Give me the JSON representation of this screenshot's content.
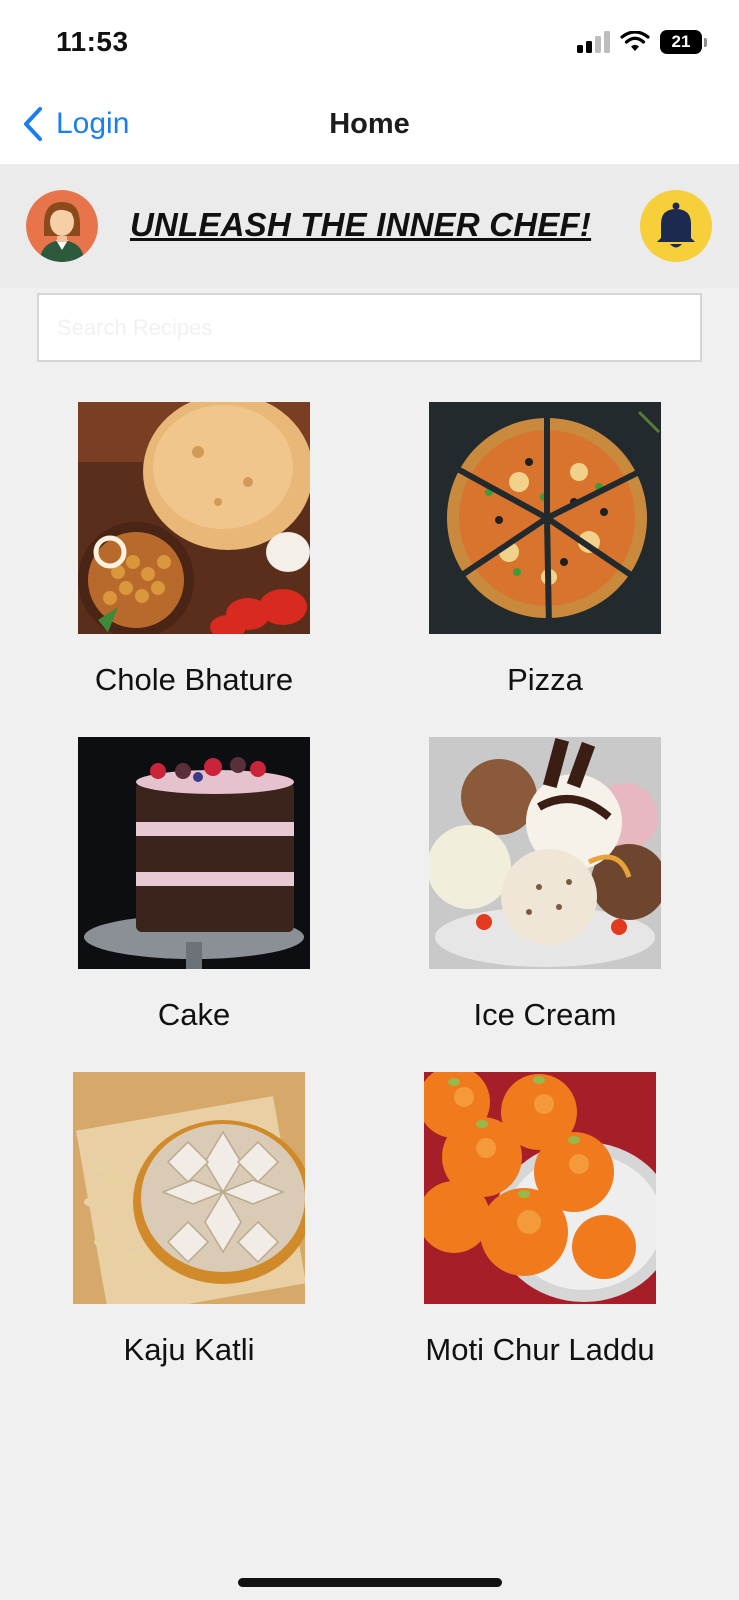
{
  "status_bar": {
    "time": "11:53",
    "battery_level": "21"
  },
  "nav": {
    "back_label": "Login",
    "title": "Home"
  },
  "header": {
    "headline": "UNLEASH THE INNER CHEF!"
  },
  "search": {
    "placeholder": "Search Recipes",
    "value": ""
  },
  "recipes": [
    {
      "name": "Chole Bhature",
      "image": "chole-bhature-photo"
    },
    {
      "name": "Pizza",
      "image": "pizza-photo"
    },
    {
      "name": "Cake",
      "image": "cake-photo"
    },
    {
      "name": "Ice Cream",
      "image": "ice-cream-photo"
    },
    {
      "name": "Kaju Katli",
      "image": "kaju-katli-photo"
    },
    {
      "name": "Moti Chur Laddu",
      "image": "moti-chur-laddu-photo"
    }
  ],
  "colors": {
    "accent": "#1a7ef2",
    "bell_bg": "#f6cf3a",
    "bell_icon": "#1b2a4e",
    "background": "#f0f0f0"
  }
}
